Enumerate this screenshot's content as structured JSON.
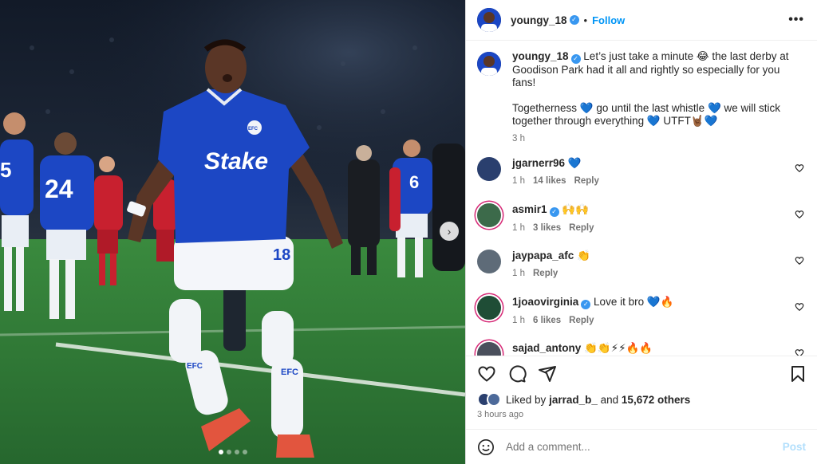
{
  "post": {
    "author": "youngy_18",
    "follow_label": "Follow",
    "separator": "•",
    "more_label": "•••",
    "next_glyph": "›",
    "carousel": {
      "count": 4,
      "active": 0
    },
    "jersey": {
      "sponsor": "Stake",
      "number": "18",
      "crest": "EFC"
    }
  },
  "caption": {
    "username": "youngy_18",
    "line1": "Let’s just take a minute 😂 the last derby at Goodison Park had it all and rightly so especially for you fans!",
    "line2": "Togetherness 💙 go until the last whistle 💙 we will stick together through everything 💙 UTFT🤘🏾💙",
    "time": "3 h"
  },
  "comments": [
    {
      "username": "jgarnerr96",
      "verified": false,
      "text": "💙",
      "time": "1 h",
      "likes": "14 likes",
      "reply": "Reply",
      "ring": false,
      "avatar_color": "#2a3f6e"
    },
    {
      "username": "asmir1",
      "verified": true,
      "text": "🙌🙌",
      "time": "1 h",
      "likes": "3 likes",
      "reply": "Reply",
      "ring": true,
      "avatar_color": "#3c6a4a"
    },
    {
      "username": "jaypapa_afc",
      "verified": false,
      "text": "👏",
      "time": "1 h",
      "likes": "",
      "reply": "Reply",
      "ring": false,
      "avatar_color": "#5e6b78"
    },
    {
      "username": "1joaovirginia",
      "verified": true,
      "text": "Love it bro 💙🔥",
      "time": "1 h",
      "likes": "6 likes",
      "reply": "Reply",
      "ring": true,
      "avatar_color": "#1f4d36"
    },
    {
      "username": "sajad_antony",
      "verified": false,
      "text": "👏👏⚡⚡🔥🔥",
      "time": "",
      "likes": "",
      "reply": "",
      "ring": true,
      "avatar_color": "#4a4f5c"
    }
  ],
  "likes": {
    "prefix": "Liked by",
    "user": "jarrad_b_",
    "and": "and",
    "others": "15,672 others"
  },
  "posted_time": "3 hours ago",
  "add_comment": {
    "placeholder": "Add a comment...",
    "post_label": "Post"
  },
  "colors": {
    "accent": "#0095f6",
    "verified": "#3897f0",
    "everton_blue": "#1c47c4",
    "pitch_green": "#2f7a3a"
  }
}
